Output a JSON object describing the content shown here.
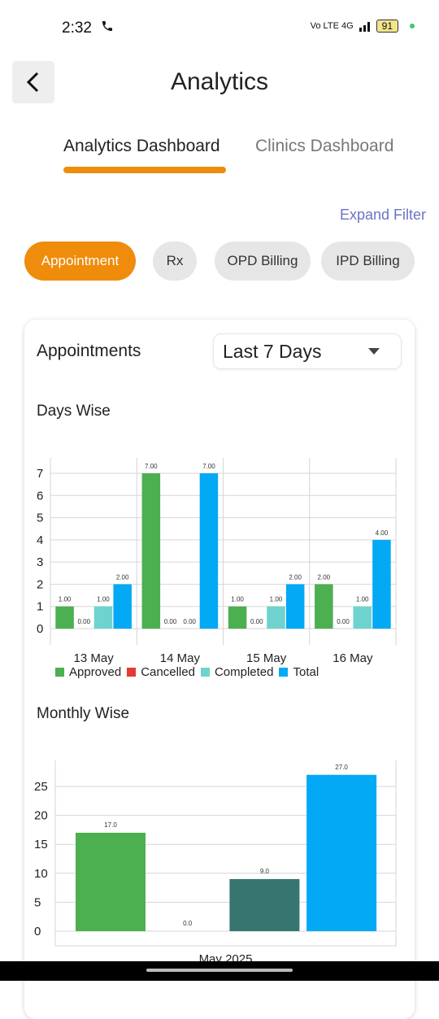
{
  "status_bar": {
    "time": "2:32",
    "network": "Vo LTE 4G",
    "battery": "91"
  },
  "header": {
    "title": "Analytics"
  },
  "tabs": [
    {
      "label": "Analytics Dashboard",
      "active": true
    },
    {
      "label": "Clinics Dashboard",
      "active": false
    }
  ],
  "expand_filter": "Expand Filter",
  "chips": [
    {
      "label": "Appointment",
      "active": true
    },
    {
      "label": "Rx",
      "active": false
    },
    {
      "label": "OPD Billing",
      "active": false
    },
    {
      "label": "IPD Billing",
      "active": false
    }
  ],
  "card": {
    "title": "Appointments",
    "period_select": "Last 7 Days",
    "days_section": "Days Wise",
    "monthly_section": "Monthly Wise"
  },
  "colors": {
    "accent": "#ef8c0b",
    "approved": "#4caf50",
    "cancelled": "#e53935",
    "completed": "#6ed3cf",
    "total": "#03a9f4",
    "monthly_completed": "#377570"
  },
  "chart_data": [
    {
      "type": "bar",
      "categories": [
        "13 May",
        "14 May",
        "15 May",
        "16 May"
      ],
      "series": [
        {
          "name": "Approved",
          "values": [
            1,
            7,
            1,
            2
          ]
        },
        {
          "name": "Cancelled",
          "values": [
            0,
            0,
            0,
            0
          ]
        },
        {
          "name": "Completed",
          "values": [
            1,
            0,
            1,
            1
          ]
        },
        {
          "name": "Total",
          "values": [
            2,
            7,
            2,
            4
          ]
        }
      ],
      "value_labels": [
        [
          "1.00",
          "0.00",
          "1.00",
          "2.00"
        ],
        [
          "7.00",
          "0.00",
          "0.00",
          "7.00"
        ],
        [
          "1.00",
          "0.00",
          "1.00",
          "2.00"
        ],
        [
          "2.00",
          "0.00",
          "1.00",
          "4.00"
        ]
      ],
      "ylim": [
        0,
        7
      ],
      "yticks": [
        "0",
        "1",
        "2",
        "3",
        "4",
        "5",
        "6",
        "7"
      ],
      "legend": "bottom",
      "grid": true
    },
    {
      "type": "bar",
      "categories": [
        "May 2025"
      ],
      "series": [
        {
          "name": "Approved",
          "values": [
            17
          ]
        },
        {
          "name": "Cancelled",
          "values": [
            0
          ]
        },
        {
          "name": "Completed",
          "values": [
            9
          ]
        },
        {
          "name": "Total",
          "values": [
            27
          ]
        }
      ],
      "value_labels": [
        "17.0",
        "0.0",
        "9.0",
        "27.0"
      ],
      "ylim": [
        0,
        27
      ],
      "yticks": [
        "0",
        "5",
        "10",
        "15",
        "20",
        "25"
      ],
      "grid": true
    }
  ]
}
